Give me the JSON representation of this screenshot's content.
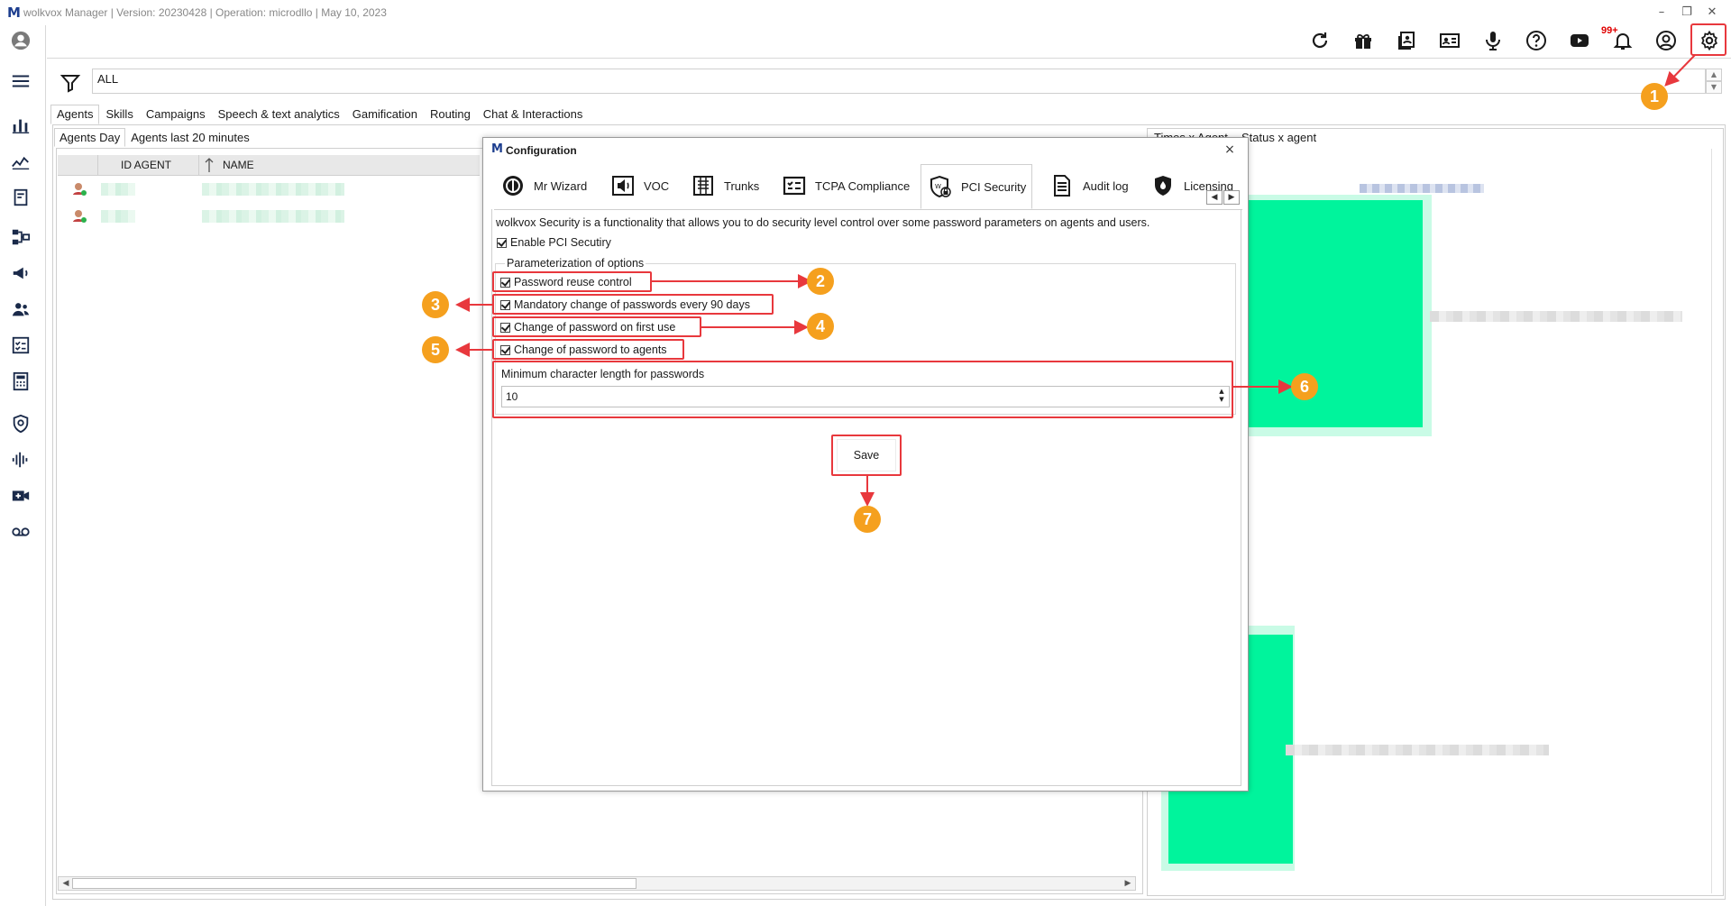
{
  "window": {
    "title": "wolkvox Manager  | Version: 20230428 |  Operation: microdllo | May 10, 2023",
    "minimize": "–",
    "restore": "❐",
    "close": "✕"
  },
  "toolbar": {
    "notification_badge": "99+",
    "icons": [
      "refresh-icon",
      "gift-icon",
      "contacts-book-icon",
      "id-card-icon",
      "microphone-icon",
      "help-icon",
      "youtube-icon",
      "bell-icon",
      "user-circle-icon",
      "gear-icon"
    ]
  },
  "sidebar": {
    "icons": [
      "avatar-icon",
      "menu-icon",
      "bar-chart-icon",
      "line-chart-icon",
      "report-icon",
      "flow-icon",
      "megaphone-icon",
      "team-icon",
      "checklist-icon",
      "calculator-icon",
      "shield-icon",
      "waveform-icon",
      "video-icon",
      "voicemail-icon"
    ]
  },
  "filter": {
    "value": "ALL"
  },
  "main_tabs": [
    "Agents",
    "Skills",
    "Campaigns",
    "Speech & text analytics",
    "Gamification",
    "Routing",
    "Chat & Interactions"
  ],
  "sub_tabs": [
    "Agents Day",
    "Agents last 20 minutes"
  ],
  "grid": {
    "columns": [
      "ID AGENT",
      "NAME"
    ]
  },
  "right_panel": {
    "tabs": [
      "Times x Agent",
      "Status x agent"
    ]
  },
  "dialog": {
    "title": "Configuration",
    "close": "×",
    "tabs": [
      {
        "label": "Mr Wizard",
        "icon": "wizard-icon"
      },
      {
        "label": "VOC",
        "icon": "speaker-icon"
      },
      {
        "label": "Trunks",
        "icon": "trunks-icon"
      },
      {
        "label": "TCPA Compliance",
        "icon": "compliance-icon"
      },
      {
        "label": "PCI Security",
        "icon": "pci-shield-icon"
      },
      {
        "label": "Audit log",
        "icon": "audit-log-icon"
      },
      {
        "label": "Licensing",
        "icon": "licensing-icon"
      }
    ],
    "tab_prev": "◀",
    "tab_next": "▶",
    "description": "wolkvox Security is a functionality that allows you to do security level control over some password parameters on agents and users.",
    "enable_pci_label": "Enable PCI Secutiry",
    "group_legend": "Parameterization of options",
    "options": [
      {
        "label": "Password reuse control",
        "checked": true
      },
      {
        "label": "Mandatory change of passwords every 90 days",
        "checked": true
      },
      {
        "label": "Change of password on first use",
        "checked": true
      },
      {
        "label": "Change of password to agents",
        "checked": true
      }
    ],
    "min_length_label": "Minimum character length for passwords",
    "min_length_value": "10",
    "save_label": "Save"
  },
  "callouts": [
    "1",
    "2",
    "3",
    "4",
    "5",
    "6",
    "7"
  ],
  "colors": {
    "callout": "#f5a01e",
    "highlight": "#e8383d",
    "bar_green": "#00f49c",
    "brand": "#1d3e8f"
  }
}
